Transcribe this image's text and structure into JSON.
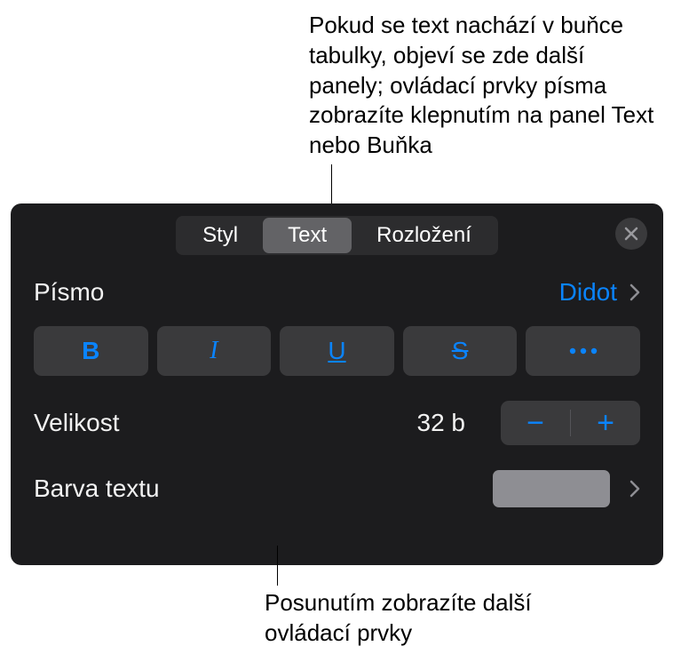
{
  "callouts": {
    "top": "Pokud se text nachází v buňce tabulky, objeví se zde další panely; ovládací prvky písma zobrazíte klepnutím na panel Text nebo Buňka",
    "bottom": "Posunutím zobrazíte další ovládací prvky"
  },
  "tabs": {
    "style": "Styl",
    "text": "Text",
    "layout": "Rozložení"
  },
  "font": {
    "label": "Písmo",
    "value": "Didot"
  },
  "style_buttons": {
    "bold": "B",
    "italic": "I",
    "underline": "U",
    "strike": "S"
  },
  "size": {
    "label": "Velikost",
    "value": "32 b",
    "minus": "−",
    "plus": "+"
  },
  "text_color": {
    "label": "Barva textu",
    "swatch": "#8e8e93"
  },
  "accent_color": "#0a84ff"
}
